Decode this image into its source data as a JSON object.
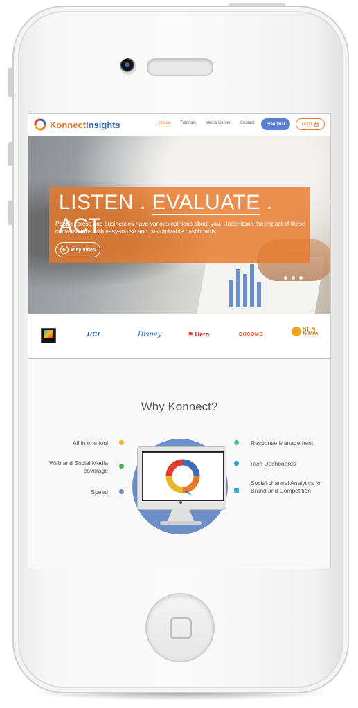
{
  "nav": {
    "logo_k": "Konnect",
    "logo_i": "Insights",
    "links": [
      "Home",
      "Tutorials",
      "Media Center",
      "Contact"
    ],
    "free_trial": "Free Trial",
    "login": "Login"
  },
  "hero": {
    "title_a": "LISTEN . ",
    "title_b": "EVALUATE",
    "title_c": " . ACT",
    "subtitle": "People, press and businesses have various opinions about you. Understand the impact of these conversations with easy-to-use and customizable dashboards",
    "play_label": "Play Video",
    "slide_count": 3
  },
  "clients": [
    "HCL",
    "Disney",
    "Hero",
    "DOCOMO",
    "SUN",
    "PHARMA"
  ],
  "why": {
    "title": "Why Konnect?",
    "left_features": [
      "All in one tool",
      "Web and Social Media coverage",
      "Speed"
    ],
    "right_features": [
      "Response Management",
      "Rich Dashboards",
      "Social channel Analytics for Brand and Competition"
    ]
  },
  "colors": {
    "brand_orange": "#e8792a",
    "brand_blue": "#5b7fd1",
    "circle_blue": "#6d8fc7"
  }
}
